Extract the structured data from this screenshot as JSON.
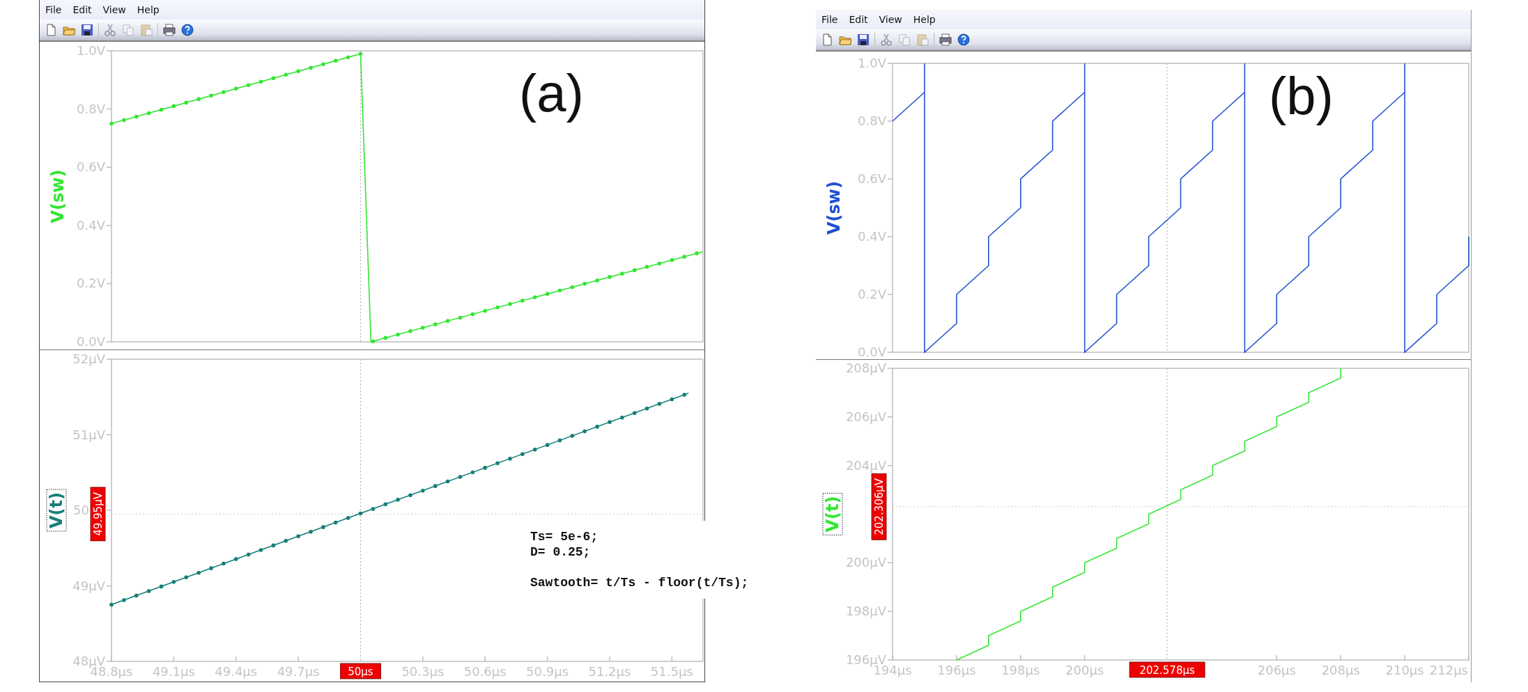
{
  "windows": [
    {
      "label": "(a)",
      "menu": [
        "File",
        "Edit",
        "View",
        "Help"
      ],
      "code_blocks": [
        [
          "Ts= 5e-6;",
          "D= 0.25;"
        ],
        [
          "Sawtooth= t/Ts - floor(t/Ts);"
        ]
      ],
      "panes": [
        {
          "axis_label_boxed": false,
          "markers": true,
          "chart_data": {
            "type": "line",
            "ylabel": "V(sw)",
            "x": [
              48.8,
              50.0,
              50.05,
              51.65
            ],
            "xlim": [
              48.8,
              51.65
            ],
            "ylim": [
              0,
              1
            ],
            "yticks": [
              {
                "value": 0,
                "label": "0.0V"
              },
              {
                "value": 0.2,
                "label": "0.2V"
              },
              {
                "value": 0.4,
                "label": "0.4V"
              },
              {
                "value": 0.6,
                "label": "0.6V"
              },
              {
                "value": 0.8,
                "label": "0.8V"
              },
              {
                "value": 1,
                "label": "1.0V"
              }
            ],
            "series": [
              {
                "color": "#33e633",
                "values": [
                  0.75,
                  0.99,
                  0.0,
                  0.31
                ]
              }
            ],
            "ref_lines": [
              {
                "axis": "x",
                "value": 50
              }
            ]
          }
        },
        {
          "axis_label_boxed": true,
          "markers": true,
          "cursor": {
            "time_label": "50µs",
            "value_label": "49.95µV"
          },
          "chart_data": {
            "type": "line",
            "ylabel": "V(t)",
            "x": [
              48.8,
              51.58
            ],
            "xlim": [
              48.8,
              51.65
            ],
            "ylim": [
              48,
              52
            ],
            "xticks": [
              {
                "value": 48.8,
                "label": "48.8µs"
              },
              {
                "value": 49.1,
                "label": "49.1µs"
              },
              {
                "value": 49.4,
                "label": "49.4µs"
              },
              {
                "value": 49.7,
                "label": "49.7µs"
              },
              {
                "value": 50.3,
                "label": "50.3µs"
              },
              {
                "value": 50.6,
                "label": "50.6µs"
              },
              {
                "value": 50.9,
                "label": "50.9µs"
              },
              {
                "value": 51.2,
                "label": "51.2µs"
              },
              {
                "value": 51.5,
                "label": "51.5µs"
              }
            ],
            "yticks": [
              {
                "value": 48,
                "label": "48µV"
              },
              {
                "value": 49,
                "label": "49µV"
              },
              {
                "value": 50,
                "label": "50"
              },
              {
                "value": 51,
                "label": "51µV"
              },
              {
                "value": 52,
                "label": "52µV"
              }
            ],
            "series": [
              {
                "color": "#157f78",
                "values": [
                  48.75,
                  51.55
                ]
              }
            ],
            "ref_lines": [
              {
                "axis": "x",
                "value": 50
              },
              {
                "axis": "y",
                "value": 49.95
              }
            ]
          }
        }
      ]
    },
    {
      "label": "(b)",
      "menu": [
        "File",
        "Edit",
        "View",
        "Help"
      ],
      "panes": [
        {
          "axis_label_boxed": false,
          "markers": false,
          "chart_data": {
            "type": "line",
            "ylabel": "V(sw)",
            "x": [
              194,
              195,
              195,
              195,
              196,
              196,
              197,
              197,
              198,
              198,
              199,
              199,
              200,
              200,
              200,
              201,
              201,
              202,
              202,
              203,
              203,
              204,
              204,
              205,
              205,
              205,
              206,
              206,
              207,
              207,
              208,
              208,
              209,
              209,
              210,
              210,
              210,
              211,
              211,
              212,
              212
            ],
            "xlim": [
              194,
              212
            ],
            "ylim": [
              0,
              1
            ],
            "yticks": [
              {
                "value": 0,
                "label": "0.0V"
              },
              {
                "value": 0.2,
                "label": "0.2V"
              },
              {
                "value": 0.4,
                "label": "0.4V"
              },
              {
                "value": 0.6,
                "label": "0.6V"
              },
              {
                "value": 0.8,
                "label": "0.8V"
              },
              {
                "value": 1,
                "label": "1.0V"
              }
            ],
            "series": [
              {
                "color": "#2050d0",
                "values": [
                  0.8,
                  0.9,
                  1.0,
                  0.0,
                  0.1,
                  0.2,
                  0.3,
                  0.4,
                  0.5,
                  0.6,
                  0.7,
                  0.8,
                  0.9,
                  1.0,
                  0.0,
                  0.1,
                  0.2,
                  0.3,
                  0.4,
                  0.5,
                  0.6,
                  0.7,
                  0.8,
                  0.9,
                  1.0,
                  0.0,
                  0.1,
                  0.2,
                  0.3,
                  0.4,
                  0.5,
                  0.6,
                  0.7,
                  0.8,
                  0.9,
                  1.0,
                  0.0,
                  0.1,
                  0.2,
                  0.3,
                  0.4
                ]
              }
            ],
            "ref_lines": [
              {
                "axis": "x",
                "value": 202.578
              }
            ]
          }
        },
        {
          "axis_label_boxed": true,
          "markers": false,
          "cursor": {
            "time_label": "202.578µs",
            "value_label": "202.306µV"
          },
          "chart_data": {
            "type": "line",
            "ylabel": "V(t)",
            "x": [
              196,
              197,
              197,
              198,
              198,
              199,
              199,
              200,
              200,
              201,
              201,
              202,
              202,
              203,
              203,
              204,
              204,
              205,
              205,
              206,
              206,
              207,
              207,
              208,
              208
            ],
            "xlim": [
              194,
              212
            ],
            "ylim": [
              196,
              208
            ],
            "xticks": [
              {
                "value": 194,
                "label": "194µs"
              },
              {
                "value": 196,
                "label": "196µs"
              },
              {
                "value": 198,
                "label": "198µs"
              },
              {
                "value": 200,
                "label": "200µs"
              },
              {
                "value": 206,
                "label": "206µs"
              },
              {
                "value": 208,
                "label": "208µs"
              },
              {
                "value": 210,
                "label": "210µs"
              },
              {
                "value": 212,
                "label": "212µs"
              }
            ],
            "yticks": [
              {
                "value": 196,
                "label": "196µV"
              },
              {
                "value": 198,
                "label": "198µV"
              },
              {
                "value": 200,
                "label": "200µV"
              },
              {
                "value": 204,
                "label": "204µV"
              },
              {
                "value": 206,
                "label": "206µV"
              },
              {
                "value": 208,
                "label": "208µV"
              }
            ],
            "series": [
              {
                "color": "#33e633",
                "values": [
                  196,
                  196.6,
                  197,
                  197.6,
                  198,
                  198.6,
                  199,
                  199.6,
                  200,
                  200.6,
                  201,
                  201.6,
                  202,
                  202.6,
                  203,
                  203.6,
                  204,
                  204.6,
                  205,
                  205.6,
                  206,
                  206.6,
                  207,
                  207.6,
                  208
                ]
              }
            ],
            "ref_lines": [
              {
                "axis": "x",
                "value": 202.578
              },
              {
                "axis": "y",
                "value": 202.306
              }
            ]
          }
        }
      ]
    }
  ]
}
